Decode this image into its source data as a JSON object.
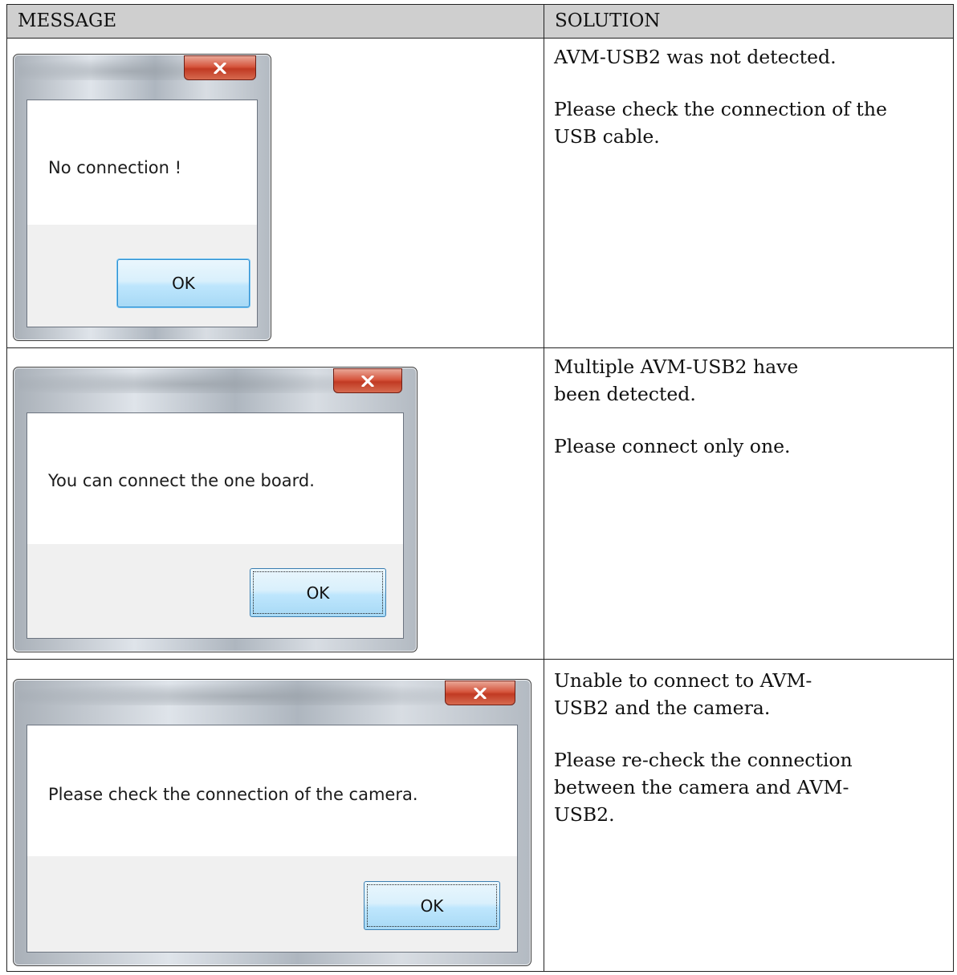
{
  "table": {
    "headers": {
      "message": "MESSAGE",
      "solution": "SOLUTION"
    },
    "rows": [
      {
        "dialog": {
          "message": "No connection !",
          "ok_label": "OK",
          "close_icon": "close-x-icon"
        },
        "solution": [
          "AVM-USB2 was not detected.",
          "Please check the connection of the USB cable."
        ]
      },
      {
        "dialog": {
          "message": "You can connect the one board.",
          "ok_label": "OK",
          "close_icon": "close-x-icon"
        },
        "solution": [
          "Multiple AVM-USB2 have been detected.",
          "Please connect only one."
        ]
      },
      {
        "dialog": {
          "message": "Please check the connection of the camera.",
          "ok_label": "OK",
          "close_icon": "close-x-icon"
        },
        "solution": [
          "Unable to connect to AVM-USB2 and the camera.",
          "Please re-check the connection between the camera and AVM-USB2."
        ]
      }
    ]
  }
}
